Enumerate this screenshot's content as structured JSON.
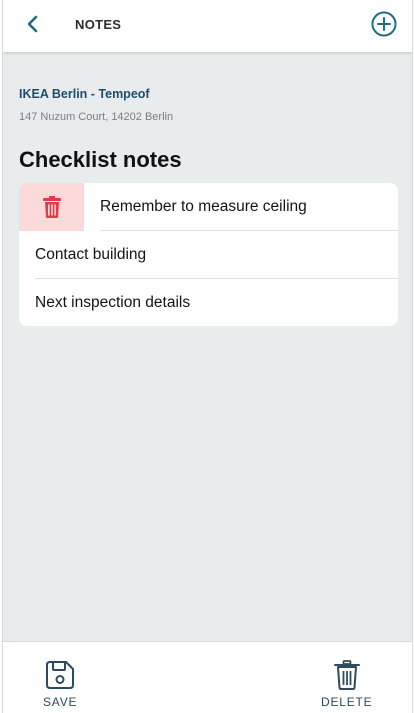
{
  "header": {
    "title": "NOTES",
    "back_icon": "chevron-left-icon",
    "add_icon": "plus-circle-icon"
  },
  "location": {
    "name": "IKEA Berlin - Tempeof",
    "address": "147 Nuzum Court, 14202 Berlin"
  },
  "section": {
    "title": "Checklist notes"
  },
  "notes": [
    {
      "label": "Remember to measure ceiling",
      "swiped": true
    },
    {
      "label": "Contact building",
      "swiped": false
    },
    {
      "label": "Next inspection details",
      "swiped": false
    }
  ],
  "swipe_action": {
    "icon": "trash-icon",
    "color": "#e23c4c",
    "background": "#fcdada"
  },
  "footer": {
    "save_label": "SAVE",
    "save_icon": "save-icon",
    "delete_label": "DELETE",
    "delete_icon": "trash-icon"
  },
  "colors": {
    "accent": "#1f6f78",
    "text_dark": "#111111",
    "location_name": "#1f4d6b",
    "background": "#e8eced"
  }
}
